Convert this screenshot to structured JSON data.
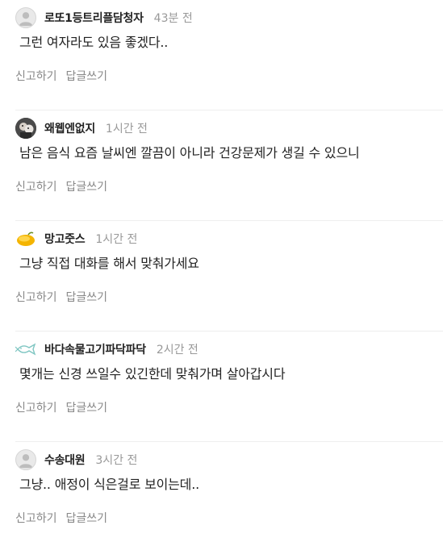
{
  "comments": [
    {
      "author": "로또1등트리플담청자",
      "time": "43분 전",
      "text": "그런 여자라도 있음 좋겠다..",
      "avatar_icon": "default-profile-icon"
    },
    {
      "author": "왜웹엔없지",
      "time": "1시간 전",
      "text": "남은 음식 요즘 날씨엔 깔끔이 아니라 건강문제가 생길 수 있으니",
      "avatar_icon": "user-photo-icon"
    },
    {
      "author": "망고줏스",
      "time": "1시간 전",
      "text": "그냥 직접 대화를 해서 맞춰가세요",
      "avatar_icon": "mango-icon"
    },
    {
      "author": "바다속물고기파닥파닥",
      "time": "2시간 전",
      "text": "몇개는 신경 쓰일수 있긴한데 맞춰가며 살아갑시다",
      "avatar_icon": "fish-icon"
    },
    {
      "author": "수송대원",
      "time": "3시간 전",
      "text": "그냥.. 애정이 식은걸로 보이는데..",
      "avatar_icon": "default-profile-icon"
    }
  ],
  "actions": {
    "report": "신고하기",
    "reply": "답글쓰기"
  },
  "colors": {
    "author": "#222222",
    "time": "#999999",
    "action": "#888888",
    "divider": "#eeeeee"
  }
}
